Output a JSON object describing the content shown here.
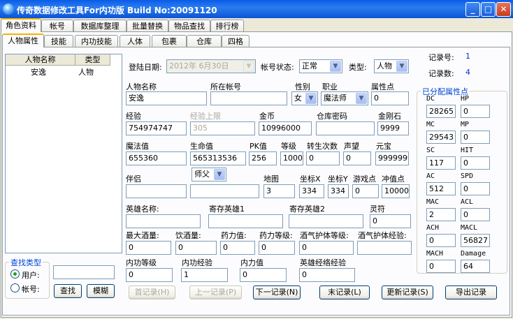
{
  "window": {
    "title": "传奇数据修改工具For内功版    Build No:20091120",
    "min": "_",
    "max": "□",
    "close": "✕"
  },
  "main_tabs": [
    "角色资料",
    "帐号",
    "数据库整理",
    "批量替换",
    "物品查找",
    "排行榜"
  ],
  "sub_tabs": [
    "人物属性",
    "技能",
    "内功技能",
    "人体",
    "包裹",
    "仓库",
    "四格"
  ],
  "list": {
    "headers": [
      "人物名称",
      "类型"
    ],
    "rows": [
      [
        "安逸",
        "人物"
      ]
    ]
  },
  "search": {
    "title": "查找类型",
    "opt_user": "用户:",
    "opt_account": "帐号:",
    "input": "",
    "find": "查找",
    "fuzzy": "模糊"
  },
  "top": {
    "login_date_label": "登陆日期:",
    "login_date": "2012年 6月30日",
    "account_status_label": "帐号状态:",
    "account_status": "正常",
    "type_label": "类型:",
    "type": "人物"
  },
  "records": {
    "no_label": "记录号:",
    "no": "1",
    "count_label": "记录数:",
    "count": "4"
  },
  "f": {
    "name_l": "人物名称",
    "name": "安逸",
    "acct_l": "所在帐号",
    "acct": "",
    "gender_l": "性别",
    "gender": "女",
    "job_l": "职业",
    "job": "魔法师",
    "attr_l": "属性点",
    "attr": "0",
    "exp_l": "经验",
    "exp": "754974747",
    "explim_l": "经验上限",
    "explim": "305",
    "gold_l": "金币",
    "gold": "10996000",
    "wpwd_l": "仓库密码",
    "wpwd": "",
    "diamond_l": "金刚石",
    "diamond": "9999",
    "mp_l": "魔法值",
    "mp": "655360",
    "hp_l": "生命值",
    "hp": "565313536",
    "pk_l": "PK值",
    "pk": "256",
    "lvl_l": "等级",
    "lvl": "1000",
    "rebirth_l": "转生次数",
    "rebirth": "0",
    "fame_l": "声望",
    "fame": "0",
    "yb_l": "元宝",
    "yb": "9999999",
    "mate_l": "伴侣",
    "mate": "",
    "master": "师父",
    "master_v": "",
    "map_l": "地图",
    "map": "3",
    "cx_l": "坐标X",
    "cx": "334",
    "cy_l": "坐标Y",
    "cy": "334",
    "gp_l": "游戏点",
    "gp": "0",
    "cz_l": "冲值点",
    "cz": "10000",
    "hero_l": "英雄名称:",
    "hero": "",
    "h1_l": "寄存英雄1",
    "h1": "",
    "h2_l": "寄存英雄2",
    "h2": "",
    "spirit_l": "灵符",
    "spirit": "0",
    "maxwine_l": "最大酒量:",
    "maxwine": "0",
    "wine_l": "饮酒量:",
    "wine": "0",
    "med_l": "药力值:",
    "med": "0",
    "medlv_l": "药力等级:",
    "medlv": "0",
    "wgl_l": "酒气护体等级:",
    "wgl": "0",
    "wge_l": "酒气护体经验:",
    "wge": "",
    "ilv_l": "内功等级",
    "ilv": "0",
    "iexp_l": "内功经验",
    "iexp": "1",
    "ival_l": "内力值",
    "ival": "0",
    "hexp_l": "英雄经络经验",
    "hexp": "0"
  },
  "stats": {
    "title": "已分配属性点",
    "items": [
      [
        "DC",
        "28265"
      ],
      [
        "HP",
        "0"
      ],
      [
        "MC",
        "29543"
      ],
      [
        "MP",
        "0"
      ],
      [
        "SC",
        "117"
      ],
      [
        "HIT",
        "0"
      ],
      [
        "AC",
        "512"
      ],
      [
        "SPD",
        "0"
      ],
      [
        "MAC",
        "2"
      ],
      [
        "ACL",
        "0"
      ],
      [
        "ACH",
        "0"
      ],
      [
        "MACL",
        "56827"
      ],
      [
        "MACH",
        "0"
      ],
      [
        "Damage",
        "64"
      ]
    ]
  },
  "nav": {
    "first": "首记录(H)",
    "prev": "上一记录(P)",
    "next": "下一记录(N)",
    "last": "末记录(L)",
    "update": "更新记录(S)",
    "export": "导出记录"
  }
}
